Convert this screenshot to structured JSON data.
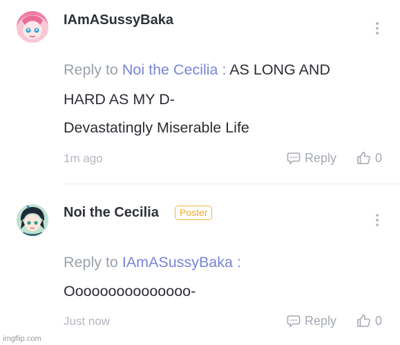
{
  "comments": [
    {
      "username": "IAmASussyBaka",
      "reply_prefix": "Reply to ",
      "mention": "Noi the Cecilia",
      "separator": " : ",
      "text_line1": "AS LONG AND",
      "text_line2": "HARD AS MY D-",
      "text_line3": "Devastatingly Miserable Life",
      "timestamp": "1m ago",
      "reply_label": "Reply",
      "like_count": "0",
      "avatar_icon": "anime-pink-hair-avatar"
    },
    {
      "username": "Noi the Cecilia",
      "badge": "Poster",
      "reply_prefix": "Reply to ",
      "mention": "IAmASussyBaka",
      "separator": " :",
      "text_line1": "Ooooooooooooooo-",
      "timestamp": "Just now",
      "reply_label": "Reply",
      "like_count": "0",
      "avatar_icon": "anime-dark-hair-avatar"
    }
  ],
  "watermark": "imgflip.com",
  "colors": {
    "mention": "#7784d6",
    "badge": "#f0a92c",
    "muted": "#a5a9b1"
  }
}
